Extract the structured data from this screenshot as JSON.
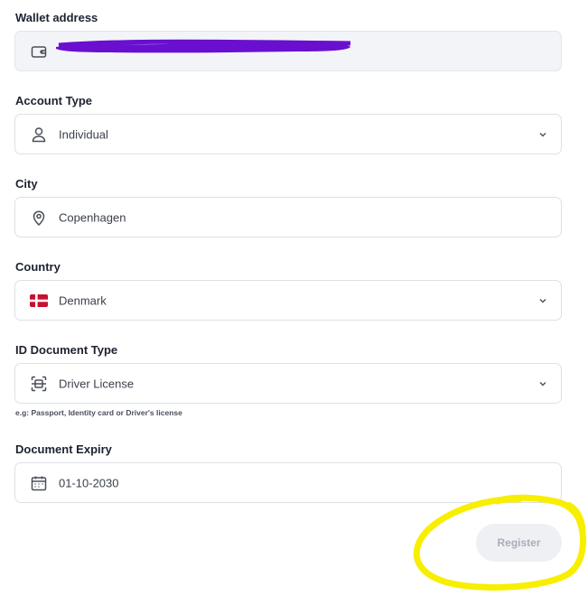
{
  "wallet": {
    "label": "Wallet address",
    "value_redacted": true,
    "icon": "wallet-icon",
    "redaction_color": "#6a0fd0"
  },
  "account_type": {
    "label": "Account Type",
    "value": "Individual",
    "icon": "user-icon"
  },
  "city": {
    "label": "City",
    "value": "Copenhagen",
    "icon": "map-pin-icon"
  },
  "country": {
    "label": "Country",
    "value": "Denmark",
    "icon": "denmark-flag-icon"
  },
  "id_document_type": {
    "label": "ID Document Type",
    "value": "Driver License",
    "icon": "scan-document-icon",
    "hint": "e.g: Passport, Identity card or Driver's license"
  },
  "document_expiry": {
    "label": "Document Expiry",
    "value": "01-10-2030",
    "icon": "calendar-icon"
  },
  "register_button": {
    "label": "Register",
    "highlight_color": "#f7ee00"
  }
}
